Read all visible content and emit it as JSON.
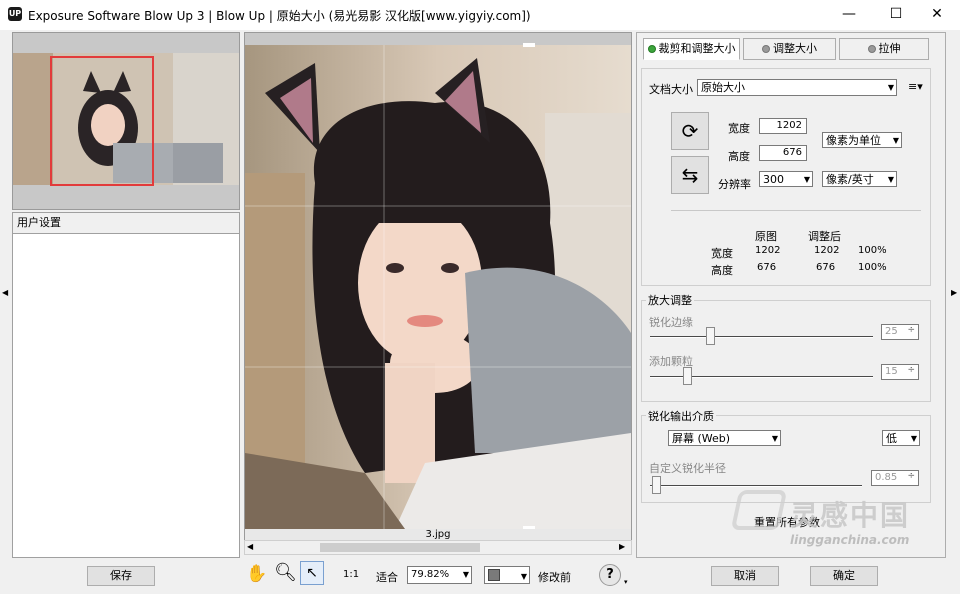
{
  "window": {
    "app_icon": "UP",
    "title": "Exposure Software Blow Up 3 | Blow Up | 原始大小    (易光易影 汉化版[www.yigyiy.com])",
    "controls": [
      "—",
      "☐",
      "✕"
    ]
  },
  "left": {
    "user_settings_label": "用户设置",
    "save_label": "保存"
  },
  "preview": {
    "filename": "3.jpg"
  },
  "toolbar": {
    "ratio_label": "1:1",
    "fit_label": "适合",
    "zoom_value": "79.82%",
    "modify_before_label": "修改前",
    "help_icon": "?"
  },
  "tabs": [
    {
      "label": "裁剪和调整大小",
      "active": true
    },
    {
      "label": "调整大小",
      "active": false
    },
    {
      "label": "拉伸",
      "active": false
    }
  ],
  "docsize": {
    "label": "文档大小",
    "value": "原始大小",
    "menu_icon": "≡▾"
  },
  "dimensions": {
    "width_label": "宽度",
    "width_value": "1202",
    "height_label": "高度",
    "height_value": "676",
    "unit_value": "像素为单位",
    "resolution_label": "分辨率",
    "resolution_value": "300",
    "resolution_unit": "像素/英寸"
  },
  "summary": {
    "col_original": "原图",
    "col_adjusted": "调整后",
    "rows": [
      {
        "label": "宽度",
        "original": "1202",
        "adjusted": "1202",
        "percent": "100%"
      },
      {
        "label": "高度",
        "original": "676",
        "adjusted": "676",
        "percent": "100%"
      }
    ]
  },
  "enlarge": {
    "title": "放大调整",
    "sharpen_label": "锐化边缘",
    "sharpen_value": "25",
    "sharpen_level": 0.25,
    "grain_label": "添加颗粒",
    "grain_value": "15",
    "grain_level": 0.15
  },
  "output": {
    "title": "锐化输出介质",
    "medium_value": "屏幕 (Web)",
    "strength_value": "低",
    "radius_label": "自定义锐化半径",
    "radius_value": "0.85"
  },
  "reset_label": "重置所有参数",
  "cancel_label": "取消",
  "ok_label": "确定",
  "watermark": {
    "text_cn": "灵感中国",
    "text_en": "lingganchina.com"
  },
  "colors": {
    "crop_rect": "#e23b3b",
    "tab_dot_active": "#3ca53c"
  }
}
